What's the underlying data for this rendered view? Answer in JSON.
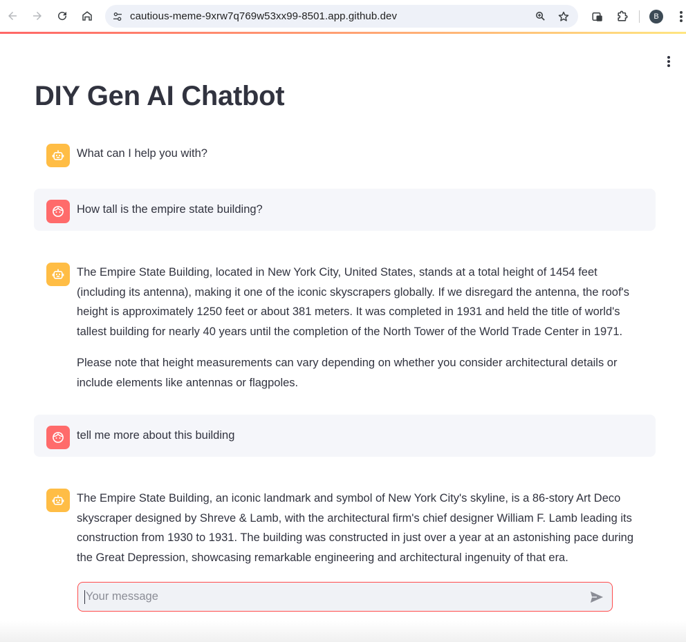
{
  "browser": {
    "url": "cautious-meme-9xrw7q769w53xx99-8501.app.github.dev",
    "profile_initial": "B",
    "icons": {
      "back": "arrow-left-icon",
      "forward": "arrow-right-icon",
      "reload": "reload-icon",
      "home": "home-icon",
      "site_info": "tune-icon",
      "zoom": "zoom-in-icon",
      "bookmark": "star-icon",
      "extension_1": "puzzle-badge-icon",
      "extensions": "puzzle-icon",
      "menu": "more-vertical-icon"
    }
  },
  "app": {
    "title": "DIY Gen AI Chatbot",
    "accent_color": "#ff4b4b",
    "bot_avatar_color": "#ffbd45",
    "user_avatar_color": "#ff6b6b",
    "messages": [
      {
        "role": "assistant",
        "paragraphs": [
          "What can I help you with?"
        ]
      },
      {
        "role": "user",
        "paragraphs": [
          "How tall is the empire state building?"
        ]
      },
      {
        "role": "assistant",
        "paragraphs": [
          "The Empire State Building, located in New York City, United States, stands at a total height of 1454 feet (including its antenna), making it one of the iconic skyscrapers globally. If we disregard the antenna, the roof's height is approximately 1250 feet or about 381 meters. It was completed in 1931 and held the title of world's tallest building for nearly 40 years until the completion of the North Tower of the World Trade Center in 1971.",
          "Please note that height measurements can vary depending on whether you consider architectural details or include elements like antennas or flagpoles."
        ]
      },
      {
        "role": "user",
        "paragraphs": [
          "tell me more about this building"
        ]
      },
      {
        "role": "assistant",
        "paragraphs": [
          "The Empire State Building, an iconic landmark and symbol of New York City's skyline, is a 86-story Art Deco skyscraper designed by Shreve & Lamb, with the architectural firm's chief designer William F. Lamb leading its construction from 1930 to 1931. The building was constructed in just over a year at an astonishing pace during the Great Depression, showcasing remarkable engineering and architectural ingenuity of that era."
        ]
      }
    ],
    "chat_input": {
      "placeholder": "Your message",
      "value": ""
    }
  }
}
